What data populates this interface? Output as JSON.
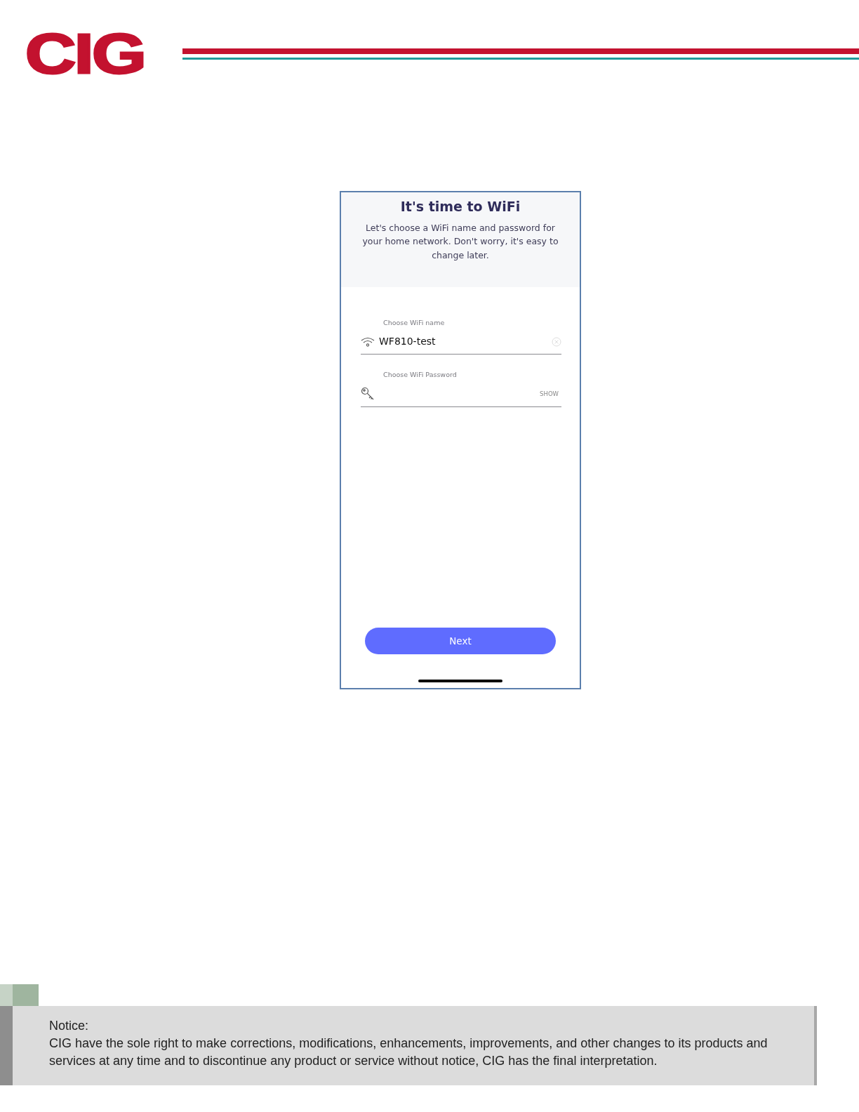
{
  "header": {
    "logo": "CIG"
  },
  "phone": {
    "title": "It's time to WiFi",
    "intro": "Let's choose a WiFi name and password for your home network. Don't worry, it's easy to change later.",
    "fields": [
      {
        "kind": "name",
        "label": "Choose WiFi name",
        "value": "WF810-test"
      },
      {
        "kind": "password",
        "label": "Choose WiFi Password",
        "toggle": "SHOW"
      }
    ],
    "button": "Next"
  },
  "notice": {
    "title": "Notice:",
    "text": "CIG have the sole right to make corrections, modifications, enhancements, improvements, and other changes to its products and services at any time and to discontinue any product or service without notice, CIG has the final interpretation."
  }
}
